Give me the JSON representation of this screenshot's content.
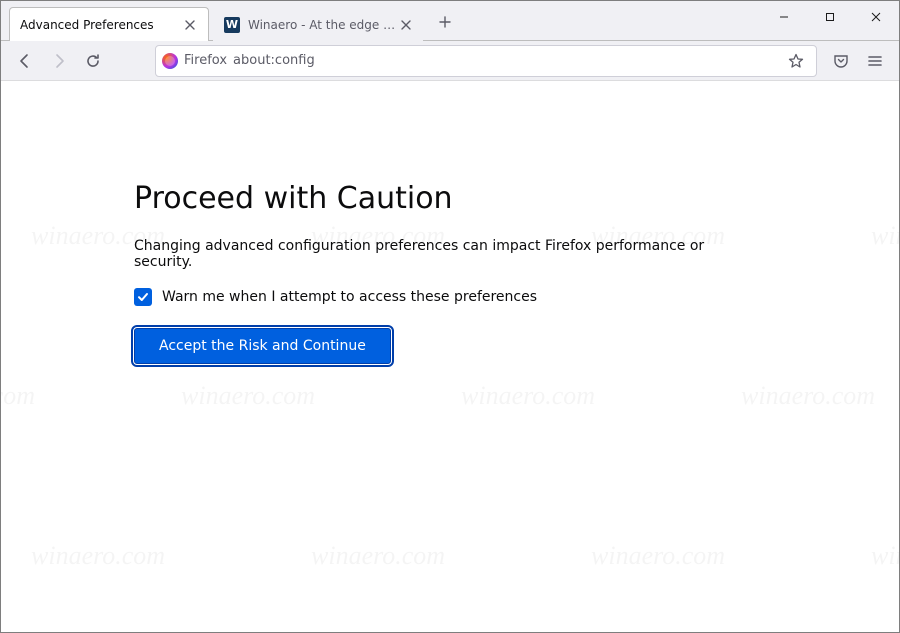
{
  "tabs": [
    {
      "title": "Advanced Preferences",
      "active": true
    },
    {
      "title": "Winaero - At the edge of tweak",
      "active": false,
      "favicon_letter": "W"
    }
  ],
  "urlbar": {
    "identity_label": "Firefox",
    "url": "about:config"
  },
  "page": {
    "heading": "Proceed with Caution",
    "description": "Changing advanced configuration preferences can impact Firefox performance or security.",
    "checkbox_label": "Warn me when I attempt to access these preferences",
    "checkbox_checked": true,
    "accept_button": "Accept the Risk and Continue"
  },
  "watermark_text": "winaero.com",
  "colors": {
    "accent_blue": "#0060df"
  }
}
